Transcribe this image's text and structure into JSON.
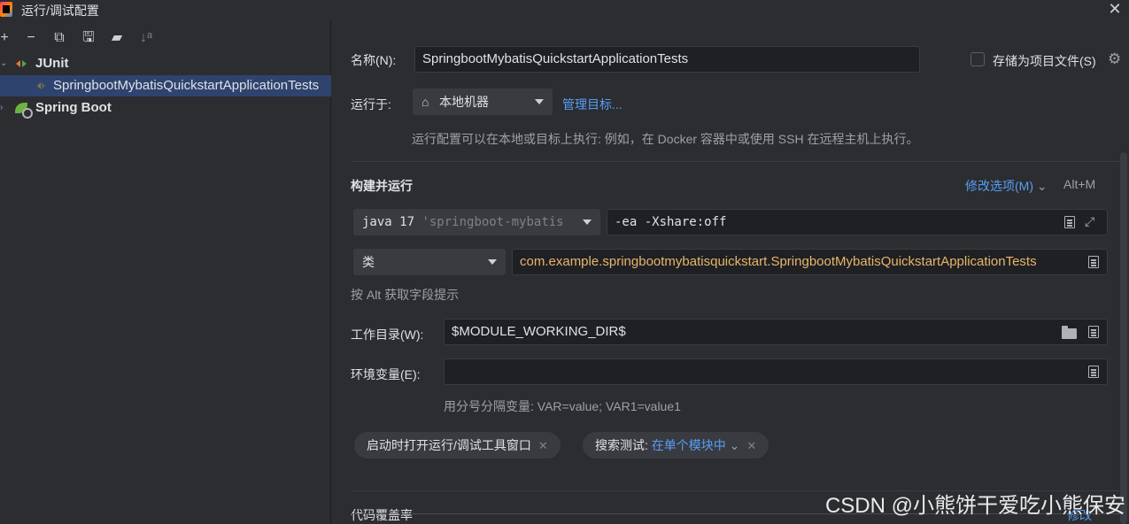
{
  "window": {
    "title": "运行/调试配置"
  },
  "left_toolbar": {
    "add": "+",
    "remove": "−",
    "copy": "⧉",
    "save": "🖫",
    "folder": "▰",
    "sort": "↓ᵃ"
  },
  "tree": {
    "junit_label": "JUnit",
    "test_label": "SpringbootMybatisQuickstartApplicationTests",
    "springboot_label": "Spring Boot"
  },
  "form": {
    "name_label": "名称(N):",
    "name_value": "SpringbootMybatisQuickstartApplicationTests",
    "store_label": "存储为项目文件(S)",
    "run_on_label": "运行于:",
    "run_on_value": "本地机器",
    "manage_targets": "管理目标...",
    "run_on_hint": "运行配置可以在本地或目标上执行: 例如，在 Docker 容器中或使用 SSH 在远程主机上执行。",
    "build_run_title": "构建并运行",
    "modify_options": "修改选项(M)",
    "modify_shortcut": "Alt+M",
    "jre_value": "java 17",
    "jre_module": "'springboot-mybatis",
    "vm_options": "-ea -Xshare:off",
    "kind_value": "类",
    "class_value": "com.example.springbootmybatisquickstart.SpringbootMybatisQuickstartApplicationTests",
    "field_hint": "按 Alt 获取字段提示",
    "workdir_label": "工作目录(W):",
    "workdir_value": "$MODULE_WORKING_DIR$",
    "env_label": "环境变量(E):",
    "env_value": "",
    "env_hint": "用分号分隔变量: VAR=value; VAR1=value1",
    "chip_open_tool_window": "启动时打开运行/调试工具窗口",
    "chip_search_prefix": "搜索测试:",
    "chip_search_value": "在单个模块中",
    "coverage_title": "代码覆盖率",
    "coverage_modify": "修改"
  },
  "watermark": "CSDN @小熊饼干爱吃小熊保安",
  "colors": {
    "background": "#2b2d30",
    "selection": "#2e436e",
    "link": "#589df6",
    "class_text": "#e8b56c"
  }
}
